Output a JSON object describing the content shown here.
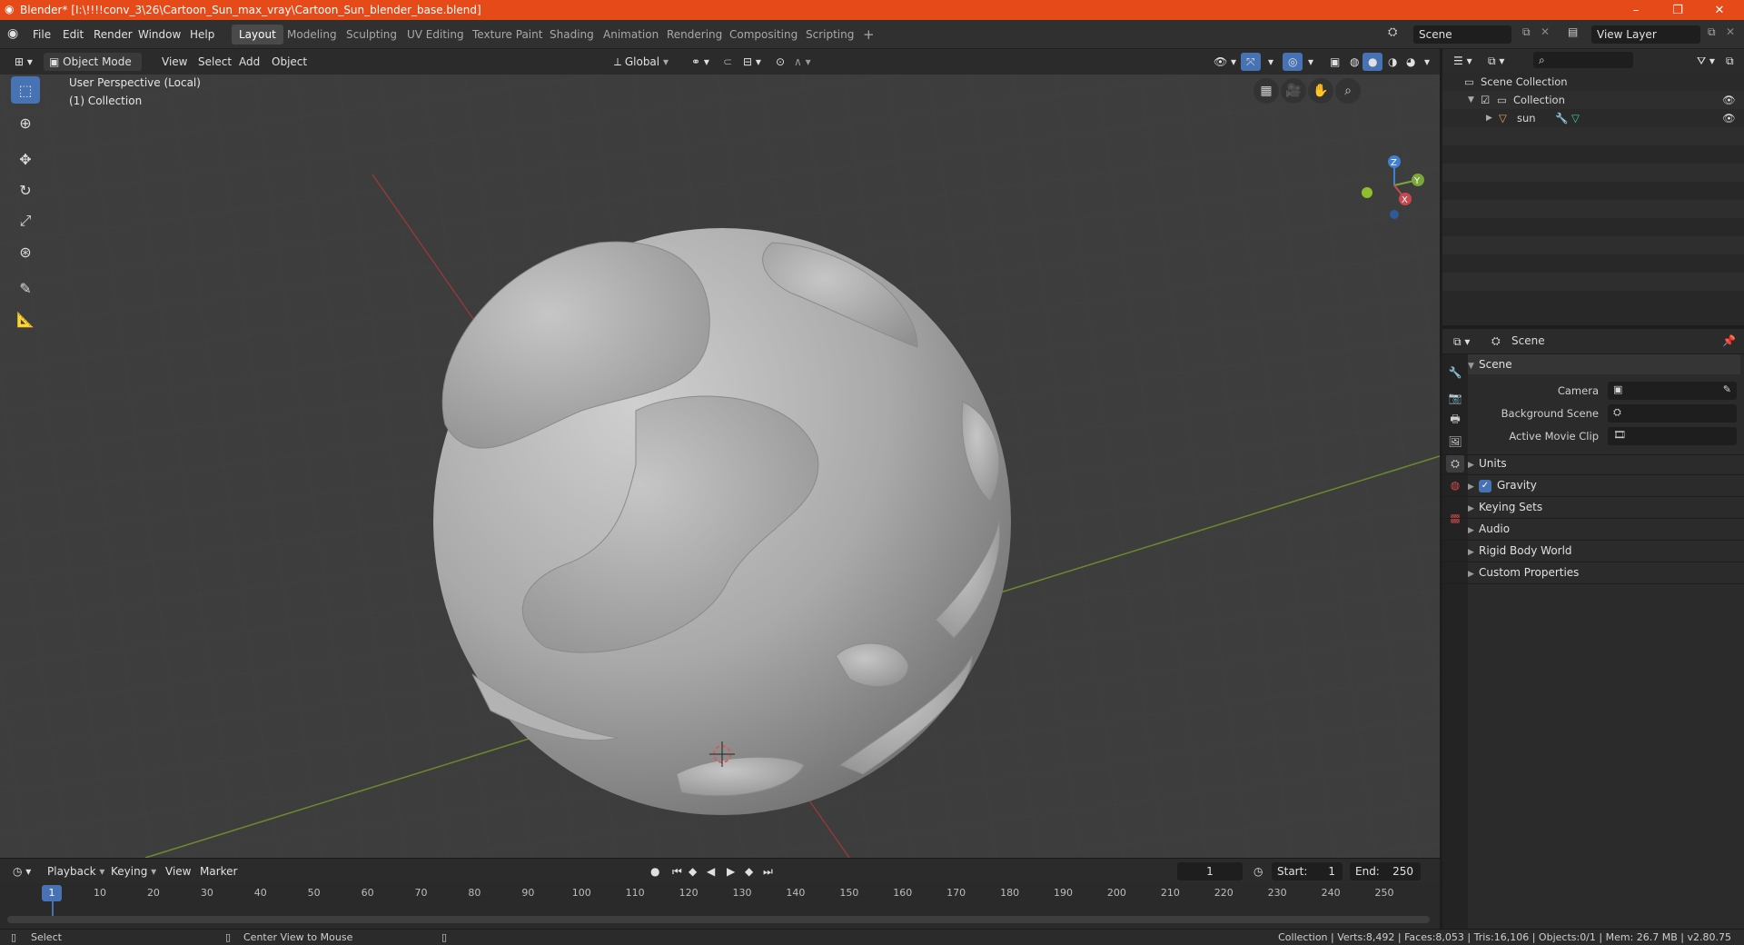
{
  "window": {
    "title": "Blender* [I:\\!!!!conv_3\\26\\Cartoon_Sun_max_vray\\Cartoon_Sun_blender_base.blend]",
    "minimize": "–",
    "restore": "❐",
    "close": "✕"
  },
  "menu": {
    "items": [
      "File",
      "Edit",
      "Render",
      "Window",
      "Help"
    ]
  },
  "workspaces": {
    "tabs": [
      "Layout",
      "Modeling",
      "Sculpting",
      "UV Editing",
      "Texture Paint",
      "Shading",
      "Animation",
      "Rendering",
      "Compositing",
      "Scripting"
    ],
    "active": "Layout",
    "add": "+"
  },
  "scene_selector": {
    "value": "Scene"
  },
  "view_layer_selector": {
    "value": "View Layer"
  },
  "viewport_header": {
    "mode": "Object Mode",
    "menus": [
      "View",
      "Select",
      "Add",
      "Object"
    ],
    "orientation": "Global"
  },
  "viewport": {
    "perspective_label": "User Perspective (Local)",
    "collection_label": "(1) Collection",
    "gizmo": {
      "z": "Z",
      "y": "Y",
      "x": "X"
    }
  },
  "outliner": {
    "rows": [
      "Scene Collection",
      "Collection",
      "sun"
    ]
  },
  "properties": {
    "header_title": "Scene",
    "panel_title": "Scene",
    "fields": {
      "camera": "Camera",
      "background_scene": "Background Scene",
      "active_movie_clip": "Active Movie Clip"
    },
    "subpanels": [
      "Units",
      "Gravity",
      "Keying Sets",
      "Audio",
      "Rigid Body World",
      "Custom Properties"
    ],
    "gravity_checked": true
  },
  "timeline": {
    "menus": [
      "Playback",
      "Keying",
      "View",
      "Marker"
    ],
    "current_frame": "1",
    "start_label": "Start:",
    "start": "1",
    "end_label": "End:",
    "end": "250",
    "ticks": [
      "1",
      "10",
      "20",
      "30",
      "40",
      "50",
      "60",
      "70",
      "80",
      "90",
      "100",
      "110",
      "120",
      "130",
      "140",
      "150",
      "160",
      "170",
      "180",
      "190",
      "200",
      "210",
      "220",
      "230",
      "240",
      "250"
    ]
  },
  "statusbar": {
    "select": "Select",
    "center_view": "Center View to Mouse",
    "stats": "Collection | Verts:8,492 | Faces:8,053 | Tris:16,106 | Objects:0/1 | Mem: 26.7 MB | v2.80.75"
  },
  "colors": {
    "titlebar": "#e64a19",
    "accent": "#4772b3",
    "axis_x": "#c8484f",
    "axis_y": "#7aa63a",
    "axis_z": "#3f7fd3"
  }
}
